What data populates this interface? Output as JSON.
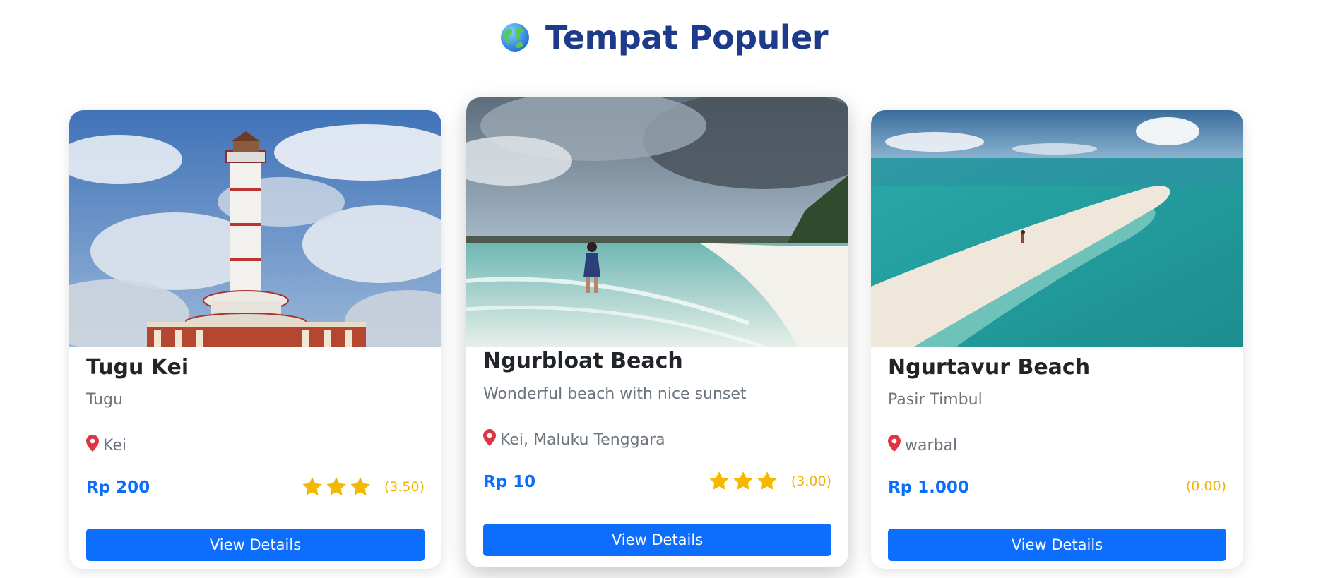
{
  "header": {
    "title": "Tempat Populer",
    "icon": "globe-icon"
  },
  "colors": {
    "title": "#1e3a8a",
    "accent": "#0d6efd",
    "star": "#f5b800",
    "pin": "#dc3545",
    "muted": "#6c757d"
  },
  "cards": [
    {
      "name": "Tugu Kei",
      "category": "Tugu",
      "location": "Kei",
      "price": "Rp 200",
      "rating_text": "(3.50)",
      "stars": 3,
      "button": "View Details",
      "image": "lighthouse-monument-photo"
    },
    {
      "name": "Ngurbloat Beach",
      "category": "Wonderful beach with nice sunset",
      "location": "Kei, Maluku Tenggara",
      "price": "Rp 10",
      "rating_text": "(3.00)",
      "stars": 3,
      "button": "View Details",
      "image": "beach-woman-photo"
    },
    {
      "name": "Ngurtavur Beach",
      "category": "Pasir Timbul",
      "location": "warbal",
      "price": "Rp 1.000",
      "rating_text": "(0.00)",
      "stars": 0,
      "button": "View Details",
      "image": "sandbar-aerial-photo"
    }
  ]
}
